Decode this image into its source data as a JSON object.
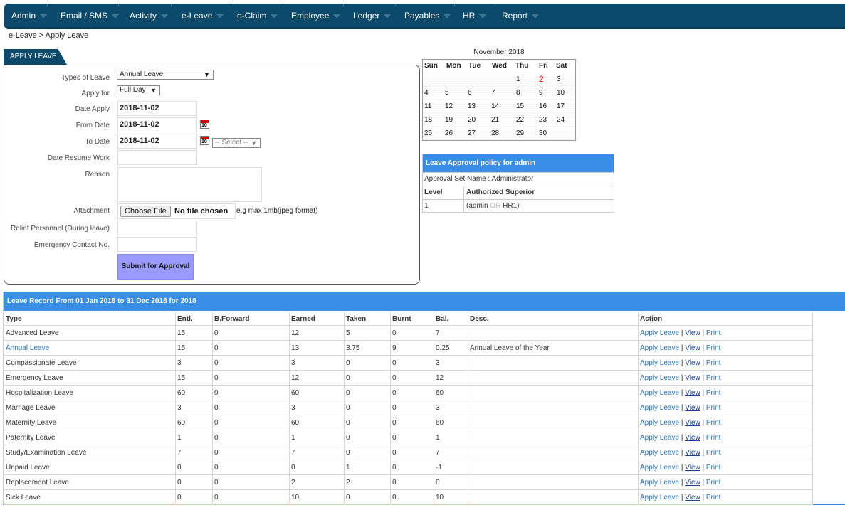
{
  "nav": {
    "items": [
      "Admin",
      "Email / SMS",
      "Activity",
      "e-Leave",
      "e-Claim",
      "Employee",
      "Ledger",
      "Payables",
      "HR",
      "Report"
    ]
  },
  "breadcrumb": "e-Leave > Apply Leave",
  "apply_leave": {
    "tab_label": "APPLY LEAVE",
    "labels": {
      "types_of_leave": "Types of Leave",
      "apply_for": "Apply for",
      "date_apply": "Date Apply",
      "from_date": "From Date",
      "to_date": "To Date",
      "date_resume": "Date Resume Work",
      "reason": "Reason",
      "attachment": "Attachment",
      "relief": "Relief Personnel (During leave)",
      "emergency": "Emergency Contact No."
    },
    "types_of_leave_value": "Annual Leave",
    "apply_for_value": "Full Day",
    "date_apply_value": "2018-11-02",
    "from_date_value": "2018-11-02",
    "to_date_value": "2018-11-02",
    "to_date_select": "-- Select --",
    "date_resume_value": "",
    "reason_value": "",
    "choose_file_label": "Choose File",
    "no_file_label": "No file chosen",
    "file_hint": "e.g max 1mb(jpeg format)",
    "relief_value": "",
    "emergency_value": "",
    "submit_label": "Submit for Approval",
    "calendar_icon_num": "10"
  },
  "calendar": {
    "title": "November 2018",
    "days": [
      "Sun",
      "Mon",
      "Tue",
      "Wed",
      "Thu",
      "Fri",
      "Sat"
    ],
    "weeks": [
      [
        "",
        "",
        "",
        "",
        "1",
        "2",
        "3"
      ],
      [
        "4",
        "5",
        "6",
        "7",
        "8",
        "9",
        "10"
      ],
      [
        "11",
        "12",
        "13",
        "14",
        "15",
        "16",
        "17"
      ],
      [
        "18",
        "19",
        "20",
        "21",
        "22",
        "23",
        "24"
      ],
      [
        "25",
        "26",
        "27",
        "28",
        "29",
        "30",
        ""
      ]
    ],
    "today": "2",
    "today_color": "#e00000"
  },
  "policy": {
    "title": "Leave Approval policy for admin",
    "approval_set": "Approval Set Name : Administrator",
    "col_level": "Level",
    "col_superior": "Authorized Superior",
    "rows": [
      {
        "level": "1",
        "open": "(admin",
        "or": "OR",
        "close": "HR1)"
      }
    ]
  },
  "record": {
    "title": "Leave Record From 01 Jan 2018 to 31 Dec 2018 for 2018",
    "columns": [
      "Type",
      "Entl.",
      "B.Forward",
      "Earned",
      "Taken",
      "Burnt",
      "Bal.",
      "Desc.",
      "Action"
    ],
    "action_apply": "Apply Leave",
    "action_view": "View",
    "action_print": "Print",
    "action_sep": "|",
    "rows": [
      {
        "type": "Advanced Leave",
        "entl": "15",
        "bf": "0",
        "earned": "12",
        "taken": "5",
        "burnt": "0",
        "bal": "7",
        "desc": "",
        "link": false
      },
      {
        "type": "Annual Leave",
        "entl": "15",
        "bf": "0",
        "earned": "13",
        "taken": "3.75",
        "burnt": "9",
        "bal": "0.25",
        "desc": "Annual Leave of the Year",
        "link": true
      },
      {
        "type": "Compassionate Leave",
        "entl": "3",
        "bf": "0",
        "earned": "3",
        "taken": "0",
        "burnt": "0",
        "bal": "3",
        "desc": "",
        "link": false
      },
      {
        "type": "Emergency Leave",
        "entl": "15",
        "bf": "0",
        "earned": "12",
        "taken": "0",
        "burnt": "0",
        "bal": "12",
        "desc": "",
        "link": false
      },
      {
        "type": "Hospitalization Leave",
        "entl": "60",
        "bf": "0",
        "earned": "60",
        "taken": "0",
        "burnt": "0",
        "bal": "60",
        "desc": "",
        "link": false
      },
      {
        "type": "Marriage Leave",
        "entl": "3",
        "bf": "0",
        "earned": "3",
        "taken": "0",
        "burnt": "0",
        "bal": "3",
        "desc": "",
        "link": false
      },
      {
        "type": "Maternity Leave",
        "entl": "60",
        "bf": "0",
        "earned": "60",
        "taken": "0",
        "burnt": "0",
        "bal": "60",
        "desc": "",
        "link": false
      },
      {
        "type": "Paternity Leave",
        "entl": "1",
        "bf": "0",
        "earned": "1",
        "taken": "0",
        "burnt": "0",
        "bal": "1",
        "desc": "",
        "link": false
      },
      {
        "type": "Study/Examination Leave",
        "entl": "7",
        "bf": "0",
        "earned": "7",
        "taken": "0",
        "burnt": "0",
        "bal": "7",
        "desc": "",
        "link": false
      },
      {
        "type": "Unpaid Leave",
        "entl": "0",
        "bf": "0",
        "earned": "0",
        "taken": "1",
        "burnt": "0",
        "bal": "-1",
        "desc": "",
        "link": false
      },
      {
        "type": "Replacement Leave",
        "entl": "0",
        "bf": "0",
        "earned": "2",
        "taken": "2",
        "burnt": "0",
        "bal": "0",
        "desc": "",
        "link": false
      },
      {
        "type": "Sick Leave",
        "entl": "0",
        "bf": "0",
        "earned": "10",
        "taken": "0",
        "burnt": "0",
        "bal": "10",
        "desc": "",
        "link": false
      }
    ]
  },
  "colors": {
    "nav_bg": "#0b4a6a",
    "header_blue": "#3a8ee6",
    "submit_bg": "#9999ff",
    "link": "#2a70b8"
  }
}
